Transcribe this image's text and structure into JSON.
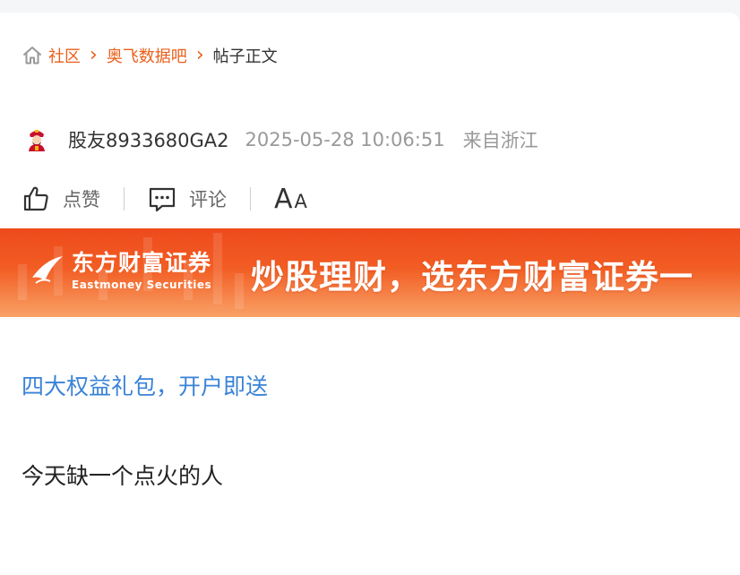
{
  "breadcrumb": {
    "home_icon": "home-icon",
    "items": [
      "社区",
      "奥飞数据吧"
    ],
    "current": "帖子正文",
    "separator": "›"
  },
  "author": {
    "avatar_icon": "fortune-god-avatar",
    "name": "股友8933680GA2",
    "time": "2025-05-28 10:06:51",
    "location": "来自浙江"
  },
  "actions": {
    "like_label": "点赞",
    "comment_label": "评论",
    "font_big": "A",
    "font_small": "A"
  },
  "banner": {
    "logo_cn": "东方财富证券",
    "logo_en": "Eastmoney Securities",
    "slogan": "炒股理财，选东方财富证券一",
    "colors": {
      "top": "#ee4a1c",
      "bottom": "#f9a267"
    }
  },
  "post": {
    "promo_link": "四大权益礼包，开户即送",
    "text": "今天缺一个点火的人"
  },
  "colors": {
    "accent": "#ea5f1a",
    "link": "#3a83d7",
    "muted": "#999999"
  }
}
